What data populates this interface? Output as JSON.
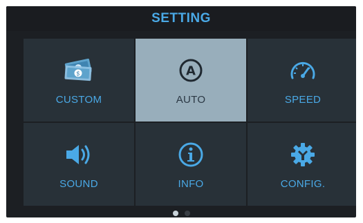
{
  "title": "SETTING",
  "tiles": [
    {
      "label": "CUSTOM",
      "icon": "money-icon",
      "active": false
    },
    {
      "label": "AUTO",
      "icon": "auto-a-icon",
      "active": true
    },
    {
      "label": "SPEED",
      "icon": "speedometer-icon",
      "active": false
    },
    {
      "label": "SOUND",
      "icon": "speaker-icon",
      "active": false
    },
    {
      "label": "INFO",
      "icon": "info-icon",
      "active": false
    },
    {
      "label": "CONFIG.",
      "icon": "gear-wrench-icon",
      "active": false
    }
  ],
  "pagination": {
    "current_page": 1,
    "total_pages": 2
  },
  "colors": {
    "accent": "#4aa9e6",
    "active_tile": "#98aebb",
    "tile": "#283138",
    "background": "#1c1f23"
  }
}
